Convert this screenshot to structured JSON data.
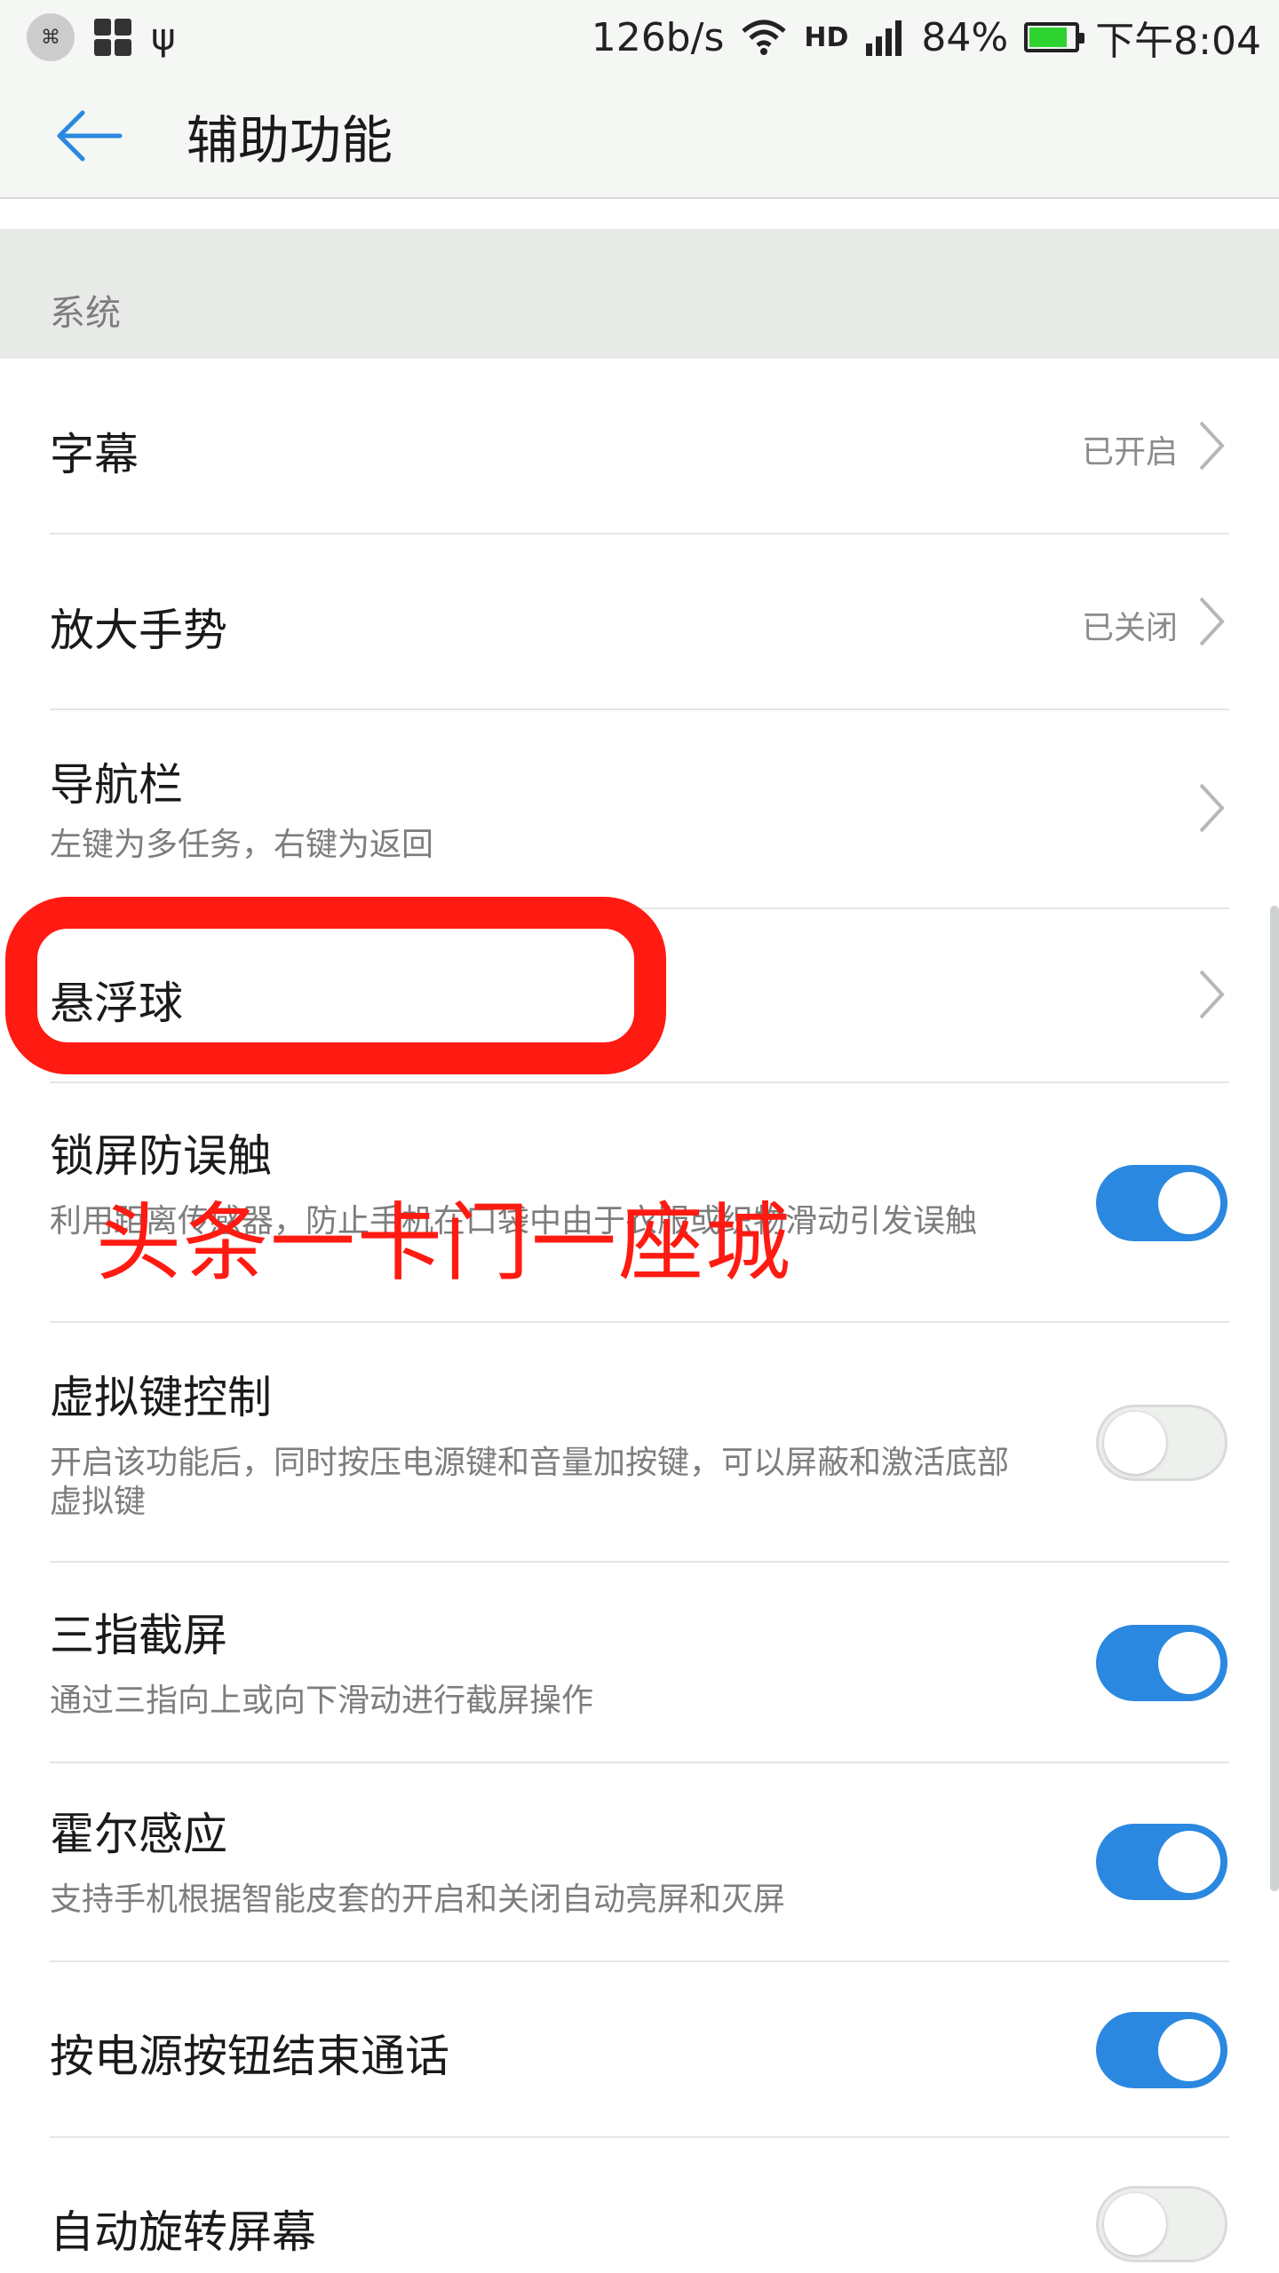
{
  "statusbar": {
    "network_speed": "126b/s",
    "hd_label": "HD",
    "battery": "84%",
    "battery_level": 0.84,
    "time": "下午8:04"
  },
  "appbar": {
    "title": "辅助功能"
  },
  "section": {
    "label": "系统"
  },
  "items": [
    {
      "title": "字幕",
      "value": "已开启"
    },
    {
      "title": "放大手势",
      "value": "已关闭"
    },
    {
      "title": "导航栏",
      "subtitle": "左键为多任务，右键为返回"
    },
    {
      "title": "悬浮球"
    },
    {
      "title": "锁屏防误触",
      "subtitle": "利用距离传感器，防止手机在口袋中由于衣服或织物滑动引发误触",
      "enabled": true
    },
    {
      "title": "虚拟键控制",
      "subtitle": "开启该功能后，同时按压电源键和音量加按键，可以屏蔽和激活底部虚拟键",
      "enabled": false
    },
    {
      "title": "三指截屏",
      "subtitle": "通过三指向上或向下滑动进行截屏操作",
      "enabled": true
    },
    {
      "title": "霍尔感应",
      "subtitle": "支持手机根据智能皮套的开启和关闭自动亮屏和灭屏",
      "enabled": true
    },
    {
      "title": "按电源按钮结束通话",
      "enabled": true
    },
    {
      "title": "自动旋转屏幕",
      "enabled": false
    }
  ],
  "watermark": "头条一卡门一座城",
  "colors": {
    "accent": "#2b88e0",
    "annotation": "#ff1a12",
    "battery": "#2fd32f"
  }
}
